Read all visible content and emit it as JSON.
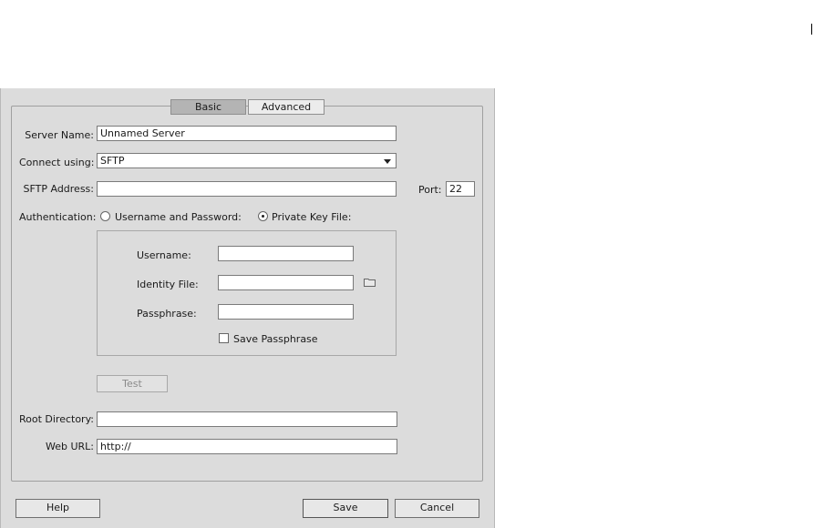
{
  "tabs": {
    "basic": "Basic",
    "advanced": "Advanced"
  },
  "server_name": {
    "label": "Server Name:",
    "value": "Unnamed Server"
  },
  "connect_using": {
    "label": "Connect using:",
    "value": "SFTP"
  },
  "address": {
    "label": "SFTP Address:",
    "value": ""
  },
  "port": {
    "label": "Port:",
    "value": "22"
  },
  "authentication": {
    "label": "Authentication:",
    "option_password": "Username and Password:",
    "option_key": "Private Key File:",
    "selected": "Private Key File:"
  },
  "key_section": {
    "username_label": "Username:",
    "username_value": "",
    "identity_label": "Identity File:",
    "identity_value": "",
    "passphrase_label": "Passphrase:",
    "passphrase_value": "",
    "save_passphrase_label": "Save Passphrase",
    "save_passphrase_checked": false,
    "browse_icon": "folder-icon"
  },
  "test_button": "Test",
  "root_directory": {
    "label": "Root Directory:",
    "value": ""
  },
  "web_url": {
    "label": "Web URL:",
    "value": "http://"
  },
  "footer": {
    "help": "Help",
    "save": "Save",
    "cancel": "Cancel"
  }
}
